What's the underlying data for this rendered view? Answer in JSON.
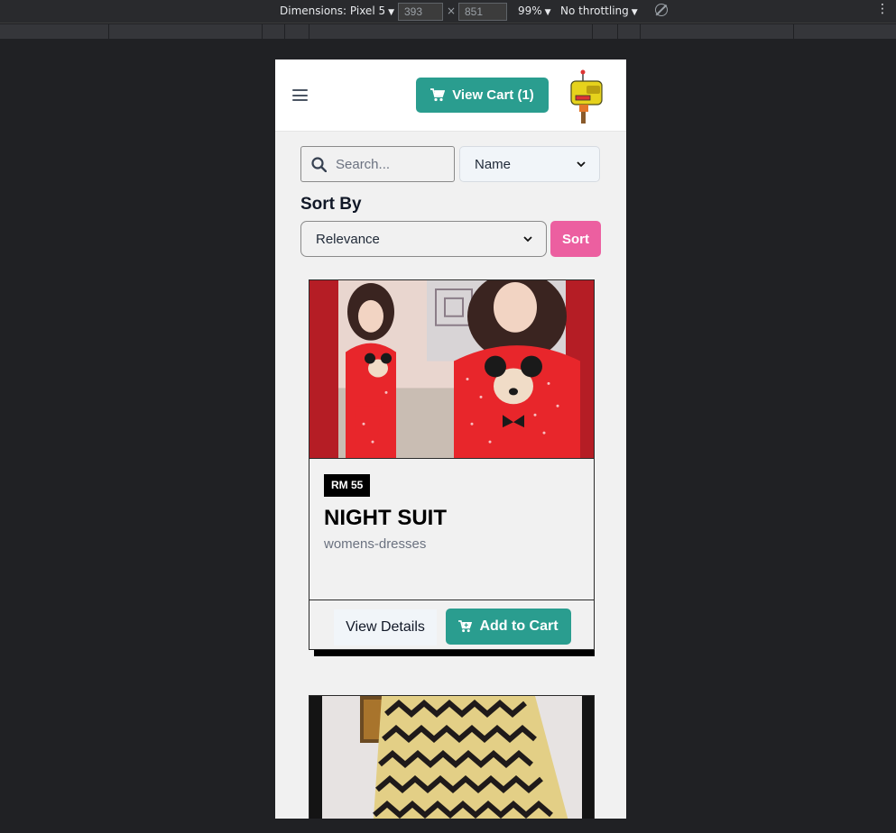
{
  "devtools": {
    "device_label": "Dimensions: Pixel 5",
    "width_value": "393",
    "height_value": "851",
    "zoom_label": "99%",
    "throttling_label": "No throttling"
  },
  "header": {
    "cart_label": "View Cart (1)"
  },
  "search": {
    "placeholder": "Search..."
  },
  "filter": {
    "selected": "Name"
  },
  "sort": {
    "heading": "Sort By",
    "selected": "Relevance",
    "button_label": "Sort"
  },
  "products": [
    {
      "price": "RM 55",
      "title": "NIGHT SUIT",
      "category": "womens-dresses",
      "details_label": "View Details",
      "add_label": "Add to Cart"
    }
  ],
  "colors": {
    "accent_teal": "#2a9d8f",
    "sort_pink": "#ec5fa0",
    "product_red": "#e8262b"
  },
  "icons": [
    "menu-icon",
    "cart-icon",
    "search-icon",
    "chevron-down-icon",
    "cart-add-icon"
  ]
}
